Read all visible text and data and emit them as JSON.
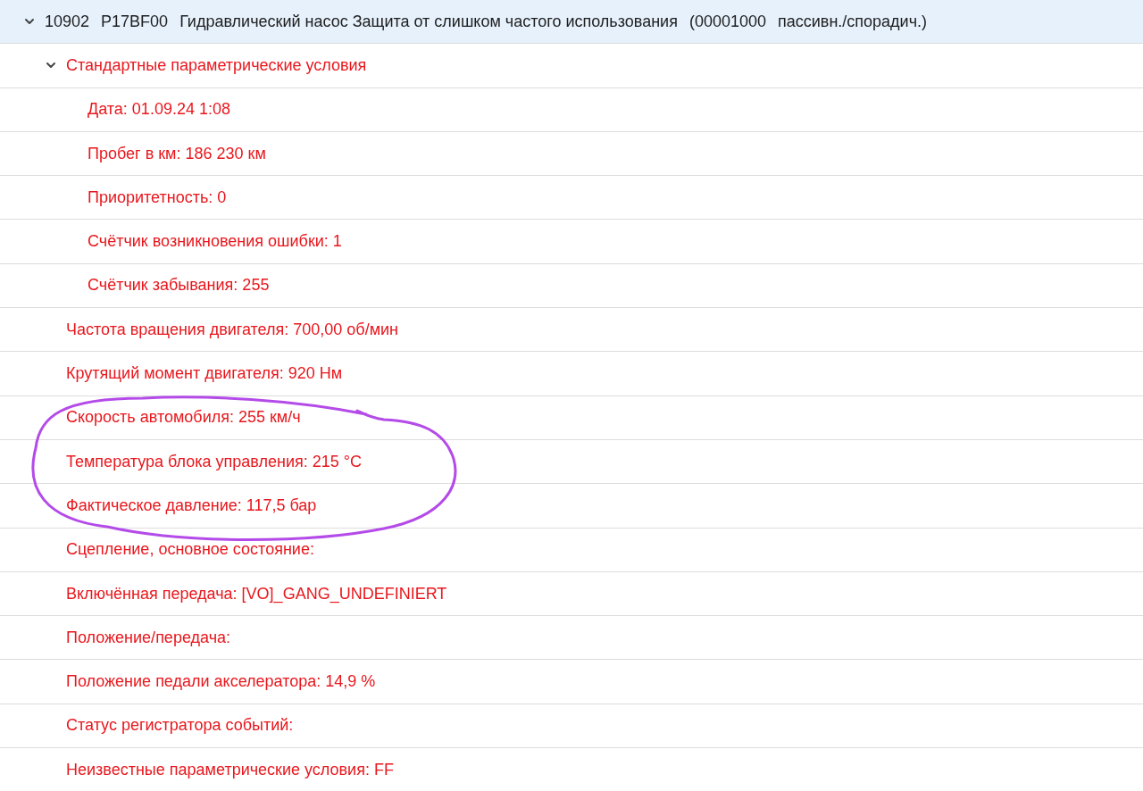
{
  "tree": [
    {
      "kind": "fault",
      "parts": [
        "10902",
        "P17BF00",
        "Гидравлический насос Защита от слишком частого использования",
        "(00001000",
        "пассивн./спорадич.)"
      ],
      "expanded": true,
      "selected": true,
      "children": [
        {
          "kind": "param",
          "label": "Стандартные параметрические условия",
          "expanded": true,
          "selected": false,
          "children": [
            {
              "kind": "param",
              "label": "Дата: 01.09.24 1:08",
              "selected": false
            },
            {
              "kind": "param",
              "label": "Пробег в км: 186 230 км",
              "selected": false
            },
            {
              "kind": "param",
              "label": "Приоритетность: 0",
              "selected": false
            },
            {
              "kind": "param",
              "label": "Счётчик возникновения ошибки: 1",
              "selected": false
            },
            {
              "kind": "param",
              "label": "Счётчик забывания: 255",
              "selected": false
            }
          ]
        },
        {
          "kind": "param",
          "label": "Частота вращения двигателя: 700,00 об/мин",
          "selected": false
        },
        {
          "kind": "param",
          "label": "Крутящий момент двигателя: 920 Нм",
          "selected": false
        },
        {
          "kind": "param",
          "label": "Скорость автомобиля: 255 км/ч",
          "selected": false
        },
        {
          "kind": "param",
          "label": "Температура блока управления: 215 °C",
          "selected": false
        },
        {
          "kind": "param",
          "label": "Фактическое давление: 117,5 бар",
          "selected": false
        },
        {
          "kind": "param",
          "label": "Сцепление, основное состояние:",
          "selected": false
        },
        {
          "kind": "param",
          "label": "Включённая передача: [VO]_GANG_UNDEFINIERT",
          "selected": false
        },
        {
          "kind": "param",
          "label": "Положение/передача:",
          "selected": false
        },
        {
          "kind": "param",
          "label": "Положение педали акселератора: 14,9 %",
          "selected": false
        },
        {
          "kind": "param",
          "label": "Статус регистратора событий:",
          "selected": false
        },
        {
          "kind": "param",
          "label": "Неизвестные параметрические условия: FF",
          "selected": false
        }
      ]
    }
  ]
}
